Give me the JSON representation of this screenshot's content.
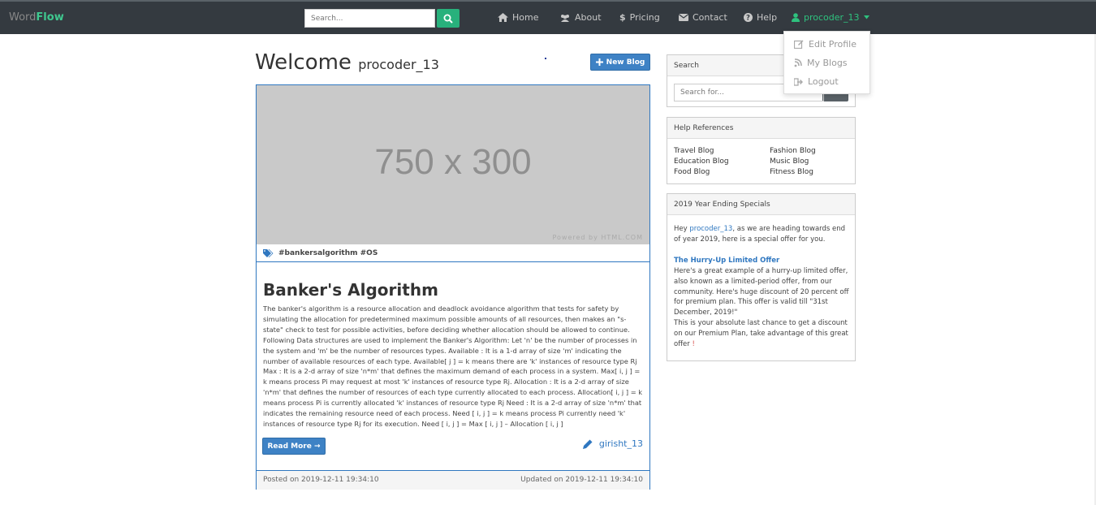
{
  "brand": {
    "word": "Word",
    "flow": "Flow"
  },
  "nav": {
    "search_placeholder": "Search...",
    "home": "Home",
    "about": "About",
    "pricing": "Pricing",
    "contact": "Contact",
    "help": "Help",
    "user": "procoder_13"
  },
  "dropdown": {
    "edit_profile": "Edit Profile",
    "my_blogs": "My Blogs",
    "logout": "Logout"
  },
  "welcome": {
    "title": "Welcome",
    "username": "procoder_13"
  },
  "new_blog_label": "New Blog",
  "post": {
    "image_text": "750 x 300",
    "image_credit": "Powered by HTML.COM",
    "tags": "#bankersalgorithm #OS",
    "title": "Banker's Algorithm",
    "body": "The banker's algorithm is a resource allocation and deadlock avoidance algorithm that tests for safety by simulating the allocation for predetermined maximum possible amounts of all resources, then makes an \"s-state\" check to test for possible activities, before deciding whether allocation should be allowed to continue. Following Data structures are used to implement the Banker's Algorithm: Let 'n' be the number of processes in the system and 'm' be the number of resources types. Available : It is a 1-d array of size 'm' indicating the number of available resources of each type. Available[ j ] = k means there are 'k' instances of resource type Rj Max : It is a 2-d array of size 'n*m' that defines the maximum demand of each process in a system. Max[ i, j ] = k means process Pi may request at most 'k' instances of resource type Rj. Allocation : It is a 2-d array of size 'n*m' that defines the number of resources of each type currently allocated to each process. Allocation[ i, j ] = k means process Pi is currently allocated 'k' instances of resource type Rj Need : It is a 2-d array of size 'n*m' that indicates the remaining resource need of each process. Need [ i, j ] = k means process Pi currently need 'k' instances of resource type Rj for its execution. Need [ i, j ] = Max [ i, j ] – Allocation [ i, j ]",
    "read_more": "Read More →",
    "author": "girisht_13",
    "posted": "Posted on 2019-12-11 19:34:10",
    "updated": "Updated on 2019-12-11 19:34:10"
  },
  "sidebar": {
    "search": {
      "title": "Search",
      "placeholder": "Search for...",
      "button": "Go!"
    },
    "help": {
      "title": "Help References",
      "links": [
        "Travel Blog",
        "Education Blog",
        "Food Blog",
        "Fashion Blog",
        "Music Blog",
        "Fitness Blog"
      ]
    },
    "special": {
      "title": "2019 Year Ending Specials",
      "hey": "Hey ",
      "user": "procoder_13",
      "intro": ", as we are heading towards end of year 2019, here is a special offer for you.",
      "offer_title": "The Hurry-Up Limited Offer",
      "offer_text": "Here's a great example of a hurry-up limited offer, also known as a limited-period offer, from our community. Here's huge discount of 20 percent off for premium plan. This offer is valid till \"31st December, 2019!\"",
      "last_chance": "This is your absolute last chance to get a discount on our Premium Plan, take advantage of this great offer ",
      "exclaim": "!"
    }
  },
  "colors": {
    "navbar": "#343a40",
    "accent_green": "#2ec27e",
    "primary_blue": "#3e82c5"
  }
}
